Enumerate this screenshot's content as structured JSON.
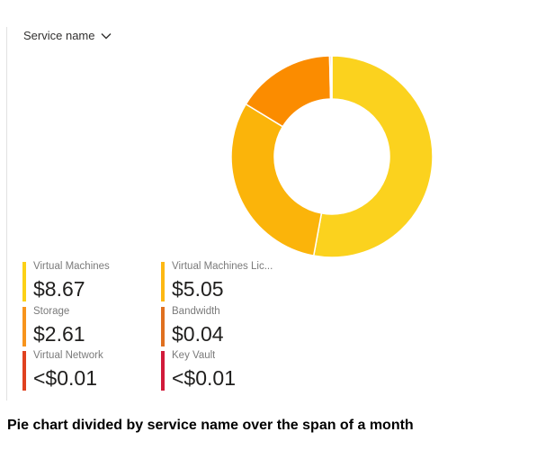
{
  "filter": {
    "label": "Service name"
  },
  "chart_data": {
    "type": "pie",
    "style": "donut",
    "categories": [
      "Virtual Machines",
      "Virtual Machines Lic...",
      "Storage",
      "Bandwidth",
      "Virtual Network",
      "Key Vault"
    ],
    "values": [
      8.67,
      5.05,
      2.61,
      0.04,
      0.01,
      0.01
    ],
    "display_values": [
      "$8.67",
      "$5.05",
      "$2.61",
      "$0.04",
      "<$0.01",
      "<$0.01"
    ],
    "colors": [
      "#FCD116",
      "#FDB813",
      "#F7A31C",
      "#E86C1F",
      "#E03E1F",
      "#D11A3A"
    ],
    "slice_colors": [
      "#FBD21E",
      "#FBB40A",
      "#FB8C00",
      "#E65100",
      "#D84315",
      "#C62828"
    ]
  },
  "caption": "Pie chart divided by service name over the span of a month"
}
